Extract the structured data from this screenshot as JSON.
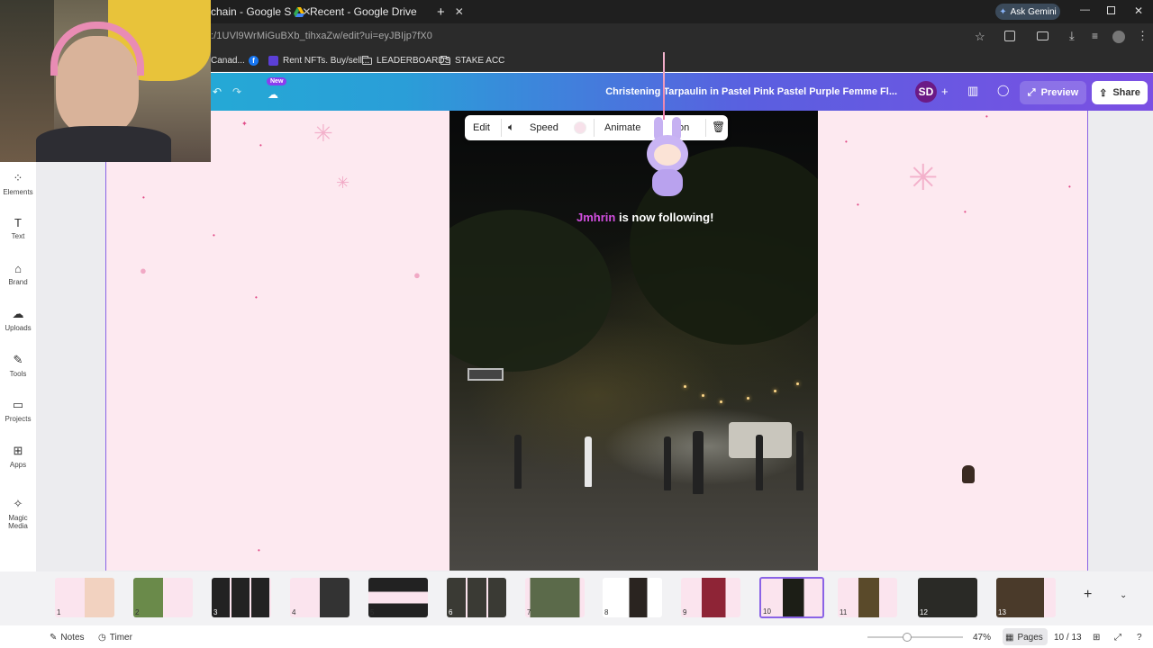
{
  "browser": {
    "tabs": [
      {
        "label": "chain - Google S"
      },
      {
        "label": "Recent - Google Drive"
      }
    ],
    "new_tab": "+",
    "ask_gemini": "Ask Gemini",
    "url": ":/1UVl9WrMiGuBXb_tihxaZw/edit?ui=eyJBIjp7fX0",
    "bookmarks": [
      "Canad...",
      "Rent NFTs. Buy/sell...",
      "LEADERBOARDS",
      "STAKE ACC"
    ]
  },
  "canva": {
    "new_badge": "New",
    "doc_title": "Christening Tarpaulin in Pastel Pink Pastel Purple Femme Fl...",
    "avatar": "SD",
    "preview_label": "Preview",
    "share_label": "Share",
    "side_items": [
      "Elements",
      "Text",
      "Brand",
      "Uploads",
      "Tools",
      "Projects",
      "Apps",
      "Magic Media"
    ],
    "toolbar": {
      "edit": "Edit",
      "speed": "Speed",
      "animate": "Animate",
      "position": "on"
    },
    "overlay": {
      "name": "Jmhrin",
      "text": "is now following!"
    },
    "pages": [
      "1",
      "2",
      "3",
      "4",
      "5",
      "6",
      "7",
      "8",
      "9",
      "10",
      "11",
      "12",
      "13"
    ],
    "bottom": {
      "notes": "Notes",
      "timer": "Timer",
      "zoom": "47%",
      "pages_label": "Pages",
      "page_counter": "10 / 13"
    }
  },
  "colors": {
    "accent": "#8a63e6",
    "page_bg": "#fde9f0",
    "header_start": "#1fb4d3",
    "header_end": "#7b4fe3"
  }
}
